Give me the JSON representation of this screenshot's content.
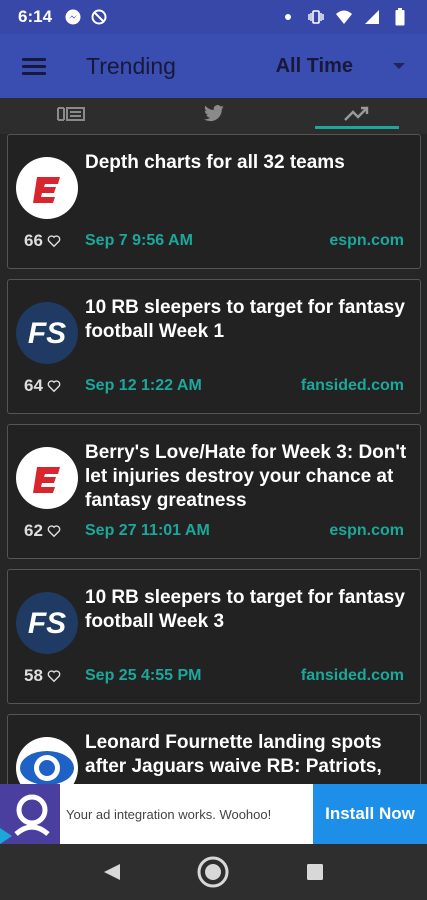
{
  "status_bar": {
    "time": "6:14"
  },
  "app_bar": {
    "title": "Trending",
    "filter_value": "All Time"
  },
  "tabs": [
    {
      "name": "newspaper",
      "icon": "newspaper-icon"
    },
    {
      "name": "twitter",
      "icon": "twitter-icon"
    },
    {
      "name": "trending",
      "icon": "trending-icon",
      "selected": true
    }
  ],
  "articles": [
    {
      "title": "Depth charts for all 32 teams",
      "likes": "66",
      "date": "Sep 7  9:56 AM",
      "source": "espn.com",
      "logo": "espn-logo"
    },
    {
      "title": "10 RB sleepers to target for fantasy football Week 1",
      "likes": "64",
      "date": "Sep 12  1:22 AM",
      "source": "fansided.com",
      "logo": "fansided-logo"
    },
    {
      "title": "Berry's Love/Hate for Week 3: Don't let injuries destroy your chance at fantasy greatness",
      "likes": "62",
      "date": "Sep 27  11:01 AM",
      "source": "espn.com",
      "logo": "espn-logo"
    },
    {
      "title": "10 RB sleepers to target for fantasy football Week 3",
      "likes": "58",
      "date": "Sep 25  4:55 PM",
      "source": "fansided.com",
      "logo": "fansided-logo"
    },
    {
      "title": "Leonard Fournette landing spots after Jaguars waive RB: Patriots,",
      "logo": "cbs-logo"
    }
  ],
  "ad": {
    "text": "Your ad integration works. Woohoo!",
    "button": "Install Now"
  },
  "colors": {
    "accent": "#1ba89b",
    "app_bar": "#3a4eb1",
    "status_bar": "#3748a8",
    "card_bg": "#222222",
    "install_button": "#1e8fe8"
  }
}
